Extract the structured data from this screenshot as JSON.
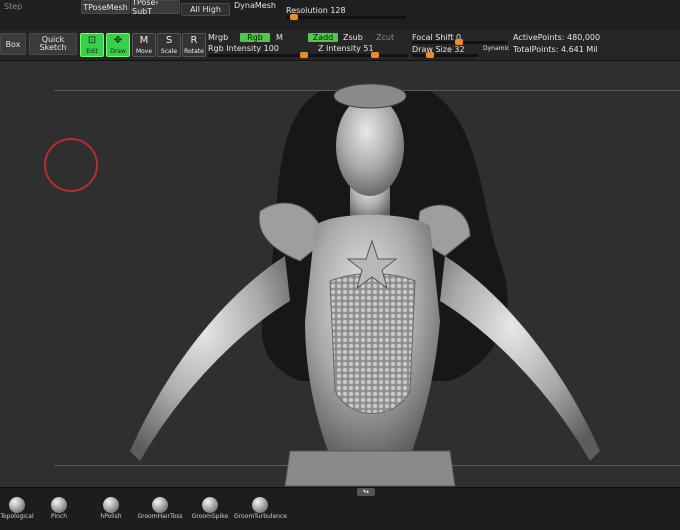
{
  "top": {
    "faded_label": "Step",
    "tpose_mesh": "TPoseMesh",
    "tpose_subt": "TPose› SubT",
    "all_high": "All High",
    "dynamesh": "DynaMesh",
    "resolution": {
      "label": "Resolution 128",
      "value": 128
    }
  },
  "toolbar": {
    "box": "Box",
    "quick_sketch": [
      "Quick",
      "Sketch"
    ],
    "edit": "Edit",
    "draw": "Draw",
    "move": "Move",
    "scale": "Scale",
    "rotate": "Rotate",
    "mrgb": "Mrgb",
    "rgb": "Rgb",
    "m": "M",
    "zadd": "Zadd",
    "zsub": "Zsub",
    "zcut": "Zcut",
    "rgb_intensity": {
      "label": "Rgb Intensity 100",
      "value": 100
    },
    "z_intensity": {
      "label": "Z Intensity 51",
      "value": 51
    },
    "focal_shift": {
      "label": "Focal Shift 0",
      "value": 0
    },
    "draw_size": {
      "label": "Draw Size 32",
      "value": 32
    },
    "dynamic": "Dynamic",
    "active_points": "ActivePoints: 480,000",
    "total_points": "TotalPoints: 4.641 Mil"
  },
  "shelf": {
    "brushes": [
      "Topological",
      "Pinch",
      "hPolish",
      "GroomHairToss",
      "GroomSpike",
      "GroomTurbulence"
    ]
  },
  "colors": {
    "accent": "#f08a24",
    "active_green": "#38d04a",
    "brush_ring": "#b52e2e"
  }
}
